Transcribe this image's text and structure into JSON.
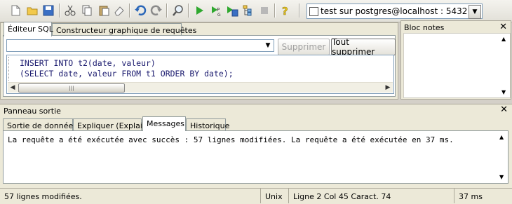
{
  "toolbar": {
    "buttons": [
      "new-file",
      "open-file",
      "save-file",
      "cut",
      "copy",
      "paste",
      "clear",
      "undo",
      "redo",
      "find",
      "execute-query",
      "execute-pgscript",
      "execute-to-file",
      "explain-query",
      "stop-query",
      "help"
    ],
    "connection": "test sur postgres@localhost : 5432"
  },
  "editor": {
    "tabs": [
      "Éditeur SQL",
      "Constructeur graphique de requêtes"
    ],
    "history_value": "",
    "delete_label": "Supprimer",
    "delete_all_label": "Tout supprimer",
    "sql_lines": [
      "INSERT INTO t2(date, valeur)",
      "(SELECT date, valeur FROM t1 ORDER BY date);"
    ]
  },
  "notes": {
    "title": "Bloc notes",
    "close": "✕"
  },
  "output": {
    "title": "Panneau sortie",
    "close": "✕",
    "tabs": [
      "Sortie de données",
      "Expliquer (Explain)",
      "Messages",
      "Historique"
    ],
    "message": "La requête a été exécutée avec succès : 57 lignes modifiées. La requête a été exécutée en 37 ms."
  },
  "status": {
    "rows": "57 lignes modifiées.",
    "eol": "Unix",
    "position": "Ligne 2 Col 45 Caract. 74",
    "time": "37 ms"
  },
  "colors": {
    "panel": "#ece9d8",
    "toolbar": "#f4f3ee",
    "border": "#aca899",
    "sql_text": "#1a1a6e"
  }
}
